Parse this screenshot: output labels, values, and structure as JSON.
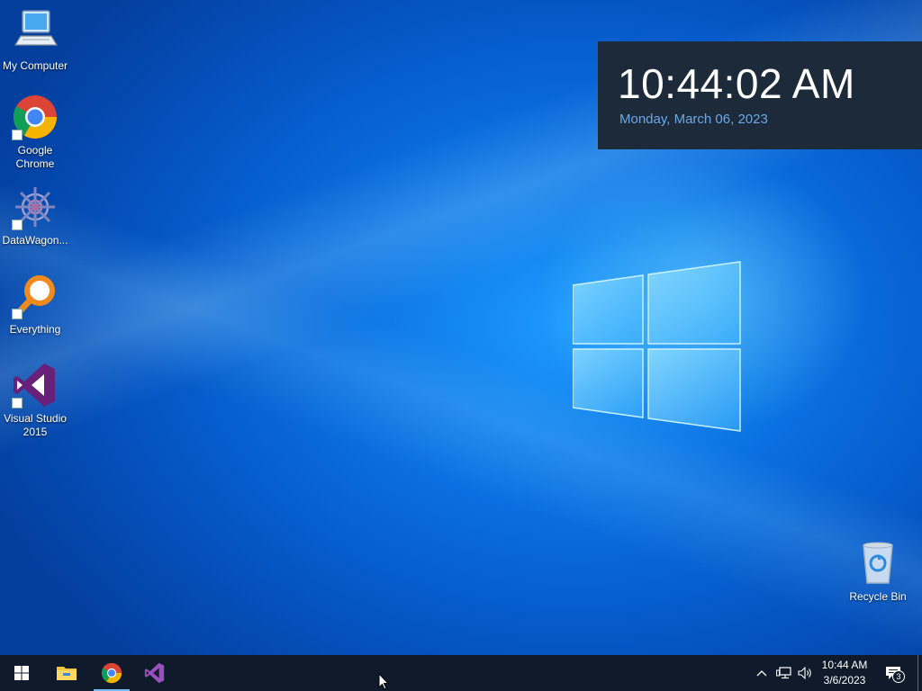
{
  "desktop": {
    "icons": [
      {
        "label": "My Computer",
        "icon": "my-computer-icon"
      },
      {
        "label": "Google Chrome",
        "icon": "chrome-icon"
      },
      {
        "label": "DataWagon...",
        "icon": "datawagon-icon"
      },
      {
        "label": "Everything",
        "icon": "everything-search-icon"
      },
      {
        "label": "Visual Studio 2015",
        "icon": "visual-studio-icon"
      }
    ],
    "recycle_bin": {
      "label": "Recycle Bin",
      "icon": "recycle-bin-icon"
    }
  },
  "clock_widget": {
    "time": "10:44:02 AM",
    "date": "Monday, March 06, 2023"
  },
  "taskbar": {
    "pinned": [
      {
        "name": "start-button",
        "icon": "windows-logo-icon"
      },
      {
        "name": "file-explorer",
        "icon": "folder-icon"
      },
      {
        "name": "google-chrome",
        "icon": "chrome-icon",
        "active": true
      },
      {
        "name": "visual-studio",
        "icon": "visual-studio-icon"
      }
    ],
    "tray": {
      "time": "10:44 AM",
      "date": "3/6/2023",
      "notification_count": "3"
    }
  },
  "colors": {
    "taskbar": "#0f1b2b",
    "clock_bg": "#1d2a3a",
    "clock_date": "#6aa8e8",
    "desktop_blue": "#0a6fe0"
  }
}
